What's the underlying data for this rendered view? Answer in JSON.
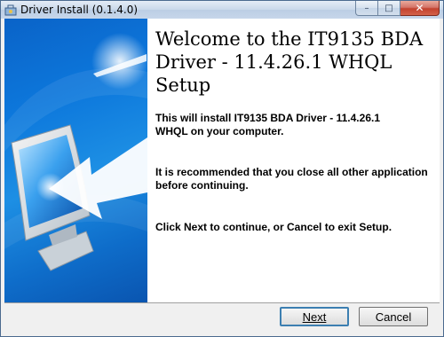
{
  "window": {
    "title": "Driver Install (0.1.4.0)",
    "caption_buttons": {
      "minimize": "–",
      "maximize": "□",
      "close": "✕"
    }
  },
  "side_panel": {
    "illustration": "monitor-with-arrow"
  },
  "content": {
    "heading": "Welcome to the IT9135 BDA Driver - 11.4.26.1 WHQL Setup",
    "paragraphs": [
      "This will install IT9135 BDA Driver - 11.4.26.1 WHQL on your computer.",
      "It is recommended that you close all other application before continuing.",
      "Click Next to continue, or Cancel to exit Setup."
    ]
  },
  "buttons": {
    "next": "Next",
    "cancel": "Cancel"
  },
  "colors": {
    "panel_blue": "#0d78dc",
    "title_bar": "#c9d8ea",
    "close_red": "#c3432f",
    "focus_border": "#3c7fb1"
  }
}
